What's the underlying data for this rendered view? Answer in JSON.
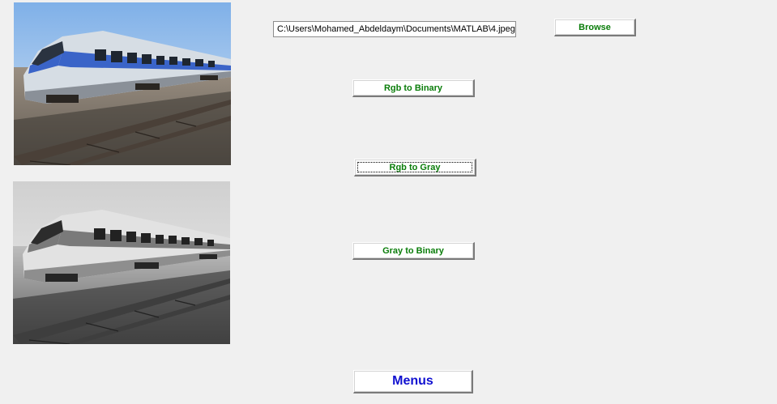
{
  "path_field": {
    "value": "C:\\Users\\Mohamed_Abdeldaym\\Documents\\MATLAB\\4.jpeg"
  },
  "buttons": {
    "browse": "Browse",
    "rgb_to_binary": "Rgb to Binary",
    "rgb_to_gray": "Rgb to Gray",
    "gray_to_binary": "Gray to Binary",
    "menus": "Menus"
  },
  "images": {
    "original": {
      "description": "color train photo"
    },
    "processed": {
      "description": "grayscale train photo"
    }
  },
  "colors": {
    "background": "#f0f0f0",
    "button_text_green": "#0a7d0a",
    "menus_text_blue": "#1010d0"
  }
}
